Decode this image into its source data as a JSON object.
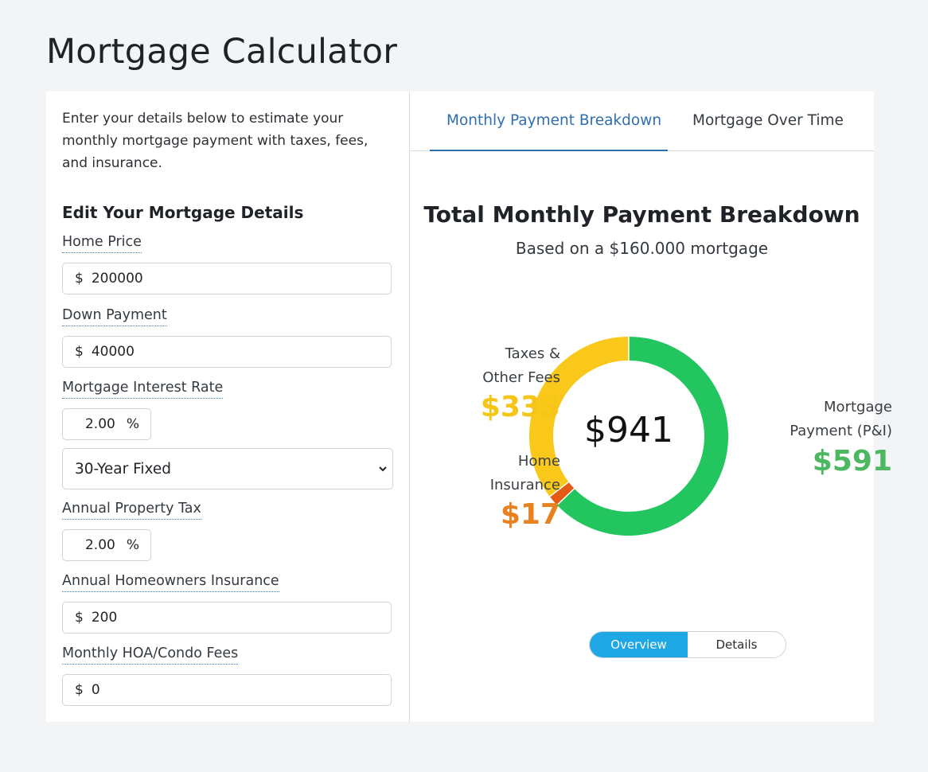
{
  "page_title": "Mortgage Calculator",
  "form": {
    "intro": "Enter your details below to estimate your monthly mortgage payment with taxes, fees, and insurance.",
    "section_title": "Edit Your Mortgage Details",
    "home_price": {
      "label": "Home Price",
      "prefix": "$",
      "value": "200000"
    },
    "down_payment": {
      "label": "Down Payment",
      "prefix": "$",
      "value": "40000"
    },
    "interest_rate": {
      "label": "Mortgage Interest Rate",
      "value": "2.00",
      "suffix": "%"
    },
    "loan_type": {
      "selected": "30-Year Fixed"
    },
    "property_tax": {
      "label": "Annual Property Tax",
      "value": "2.00",
      "suffix": "%"
    },
    "insurance": {
      "label": "Annual Homeowners Insurance",
      "prefix": "$",
      "value": "200"
    },
    "hoa": {
      "label": "Monthly HOA/Condo Fees",
      "prefix": "$",
      "value": "0"
    }
  },
  "tabs": [
    {
      "label": "Monthly Payment Breakdown",
      "active": true
    },
    {
      "label": "Mortgage Over Time",
      "active": false
    }
  ],
  "breakdown": {
    "title": "Total Monthly Payment Breakdown",
    "subtitle": "Based on a $160.000 mortgage",
    "total": "$941",
    "taxes": {
      "label_line1": "Taxes &",
      "label_line2": "Other Fees",
      "value": "$333",
      "color": "#f5c518"
    },
    "insurance": {
      "label_line1": "Home",
      "label_line2": "Insurance",
      "value": "$17",
      "color": "#e8811f"
    },
    "mortgage": {
      "label_line1": "Mortgage",
      "label_line2": "Payment (P&I)",
      "value": "$591",
      "color": "#4cb861"
    }
  },
  "chart_data": {
    "type": "pie",
    "categories": [
      "Mortgage Payment (P&I)",
      "Home Insurance",
      "Taxes & Other Fees"
    ],
    "values": [
      591,
      17,
      333
    ],
    "colors": [
      "#22c55e",
      "#e25a14",
      "#f9c81a"
    ]
  },
  "toggle": {
    "overview": "Overview",
    "details": "Details"
  }
}
